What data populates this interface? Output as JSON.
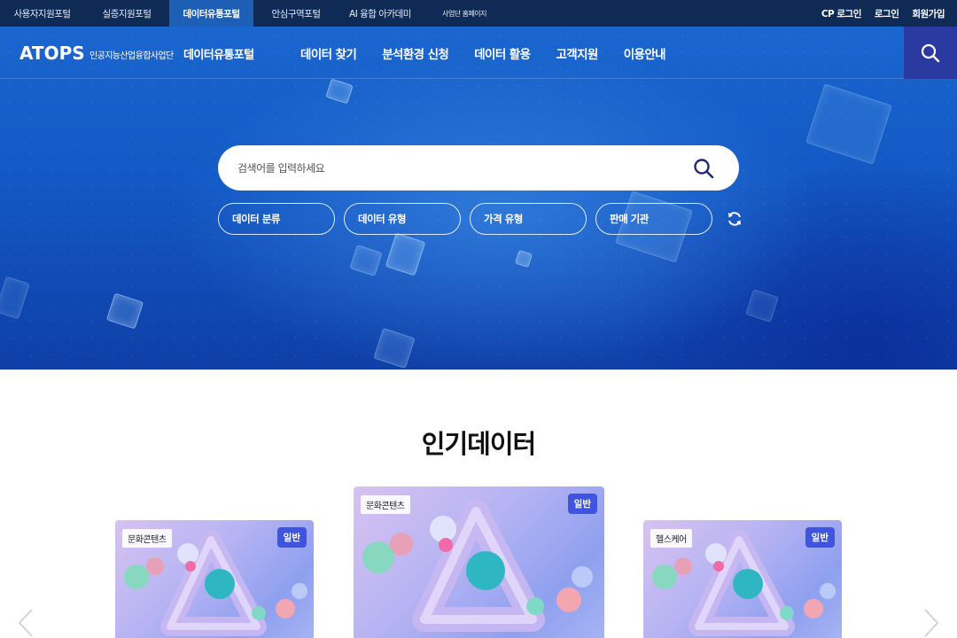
{
  "topbar": {
    "portals": [
      {
        "label": "사용자지원포털"
      },
      {
        "label": "실증지원포털"
      },
      {
        "label": "데이터유통포털"
      },
      {
        "label": "안심구역포털"
      },
      {
        "label": "AI 융합 아카데미"
      },
      {
        "label": "사업단 홈페이지"
      }
    ],
    "active_portal": "데이터유통포털",
    "links": [
      {
        "label": "CP 로그인"
      },
      {
        "label": "로그인"
      },
      {
        "label": "회원가입"
      }
    ]
  },
  "header": {
    "logo": "ATOPS",
    "org": "인공지능산업융합사업단",
    "portal_name": "데이터유통포털",
    "menu": [
      {
        "label": "데이터 찾기"
      },
      {
        "label": "분석환경 신청"
      },
      {
        "label": "데이터 활용"
      },
      {
        "label": "고객지원"
      },
      {
        "label": "이용안내"
      }
    ],
    "search_icon": "search-icon"
  },
  "hero": {
    "search": {
      "placeholder": "검색어를 입력하세요",
      "value": ""
    },
    "filters": [
      {
        "label": "데이터 분류"
      },
      {
        "label": "데이터 유형"
      },
      {
        "label": "가격 유형"
      },
      {
        "label": "판매 기관"
      }
    ],
    "refresh_icon": "refresh-icon"
  },
  "popular": {
    "title": "인기데이터",
    "cards": [
      {
        "category": "문화콘텐츠",
        "badge": "일반"
      },
      {
        "category": "문화콘텐츠",
        "badge": "일반"
      },
      {
        "category": "헬스케어",
        "badge": "일반"
      }
    ],
    "prev_icon": "chevron-left-icon",
    "next_icon": "chevron-right-icon"
  },
  "colors": {
    "topbar_bg": "#0e2a55",
    "active_tab": "#1d5fb4",
    "hero_blue": "#1358c4",
    "search_button_bg": "#2a3aa0",
    "badge_blue": "#3f55df"
  }
}
